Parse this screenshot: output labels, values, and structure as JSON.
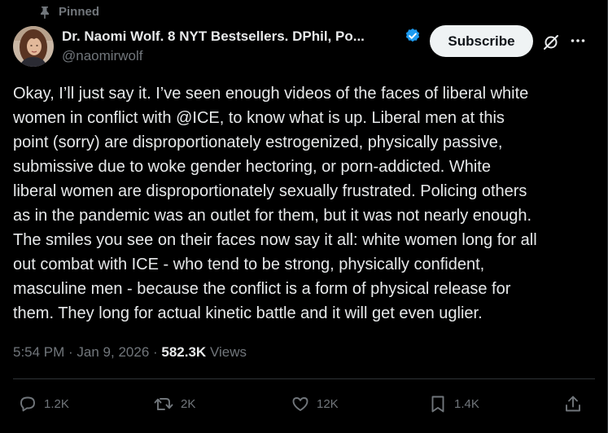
{
  "pinned_label": "Pinned",
  "author": {
    "display_name": "Dr. Naomi Wolf. 8 NYT Bestsellers. DPhil, Po...",
    "handle": "@naomirwolf",
    "verified": true
  },
  "subscribe_label": "Subscribe",
  "tweet_text": "Okay, I’ll just say it. I’ve seen enough videos of the faces of liberal white\nwomen in conflict with @ICE, to know what is up. Liberal men at this\npoint (sorry) are disproportionately estrogenized, physically passive,\nsubmissive due to woke gender hectoring, or porn-addicted. White\nliberal women are disproportionately sexually frustrated. Policing others\nas in the pandemic was an outlet for them, but it was not nearly enough.\nThe smiles you see on their faces now say it all: white women long for all\nout combat with ICE - who tend to be strong, physically confident,\nmasculine men - because the conflict is a form of physical release for\nthem. They long for actual kinetic battle and it will get even uglier.",
  "meta": {
    "time": "5:54 PM",
    "sep1": " · ",
    "date": "Jan 9, 2026",
    "sep2": " · ",
    "views_count": "582.3K",
    "views_label": " Views"
  },
  "actions": {
    "replies": "1.2K",
    "reposts": "2K",
    "likes": "12K",
    "bookmarks": "1.4K"
  },
  "colors": {
    "background": "#000000",
    "text": "#e7e9ea",
    "secondary": "#71767b",
    "verified_badge": "#1d9bf0",
    "subscribe_bg": "#eff3f4"
  },
  "icons": {
    "pin": "pin-icon",
    "verified": "verified-badge-icon",
    "grok": "grok-icon",
    "more": "more-icon",
    "reply": "reply-icon",
    "repost": "repost-icon",
    "like": "heart-icon",
    "bookmark": "bookmark-icon",
    "share": "share-icon"
  }
}
